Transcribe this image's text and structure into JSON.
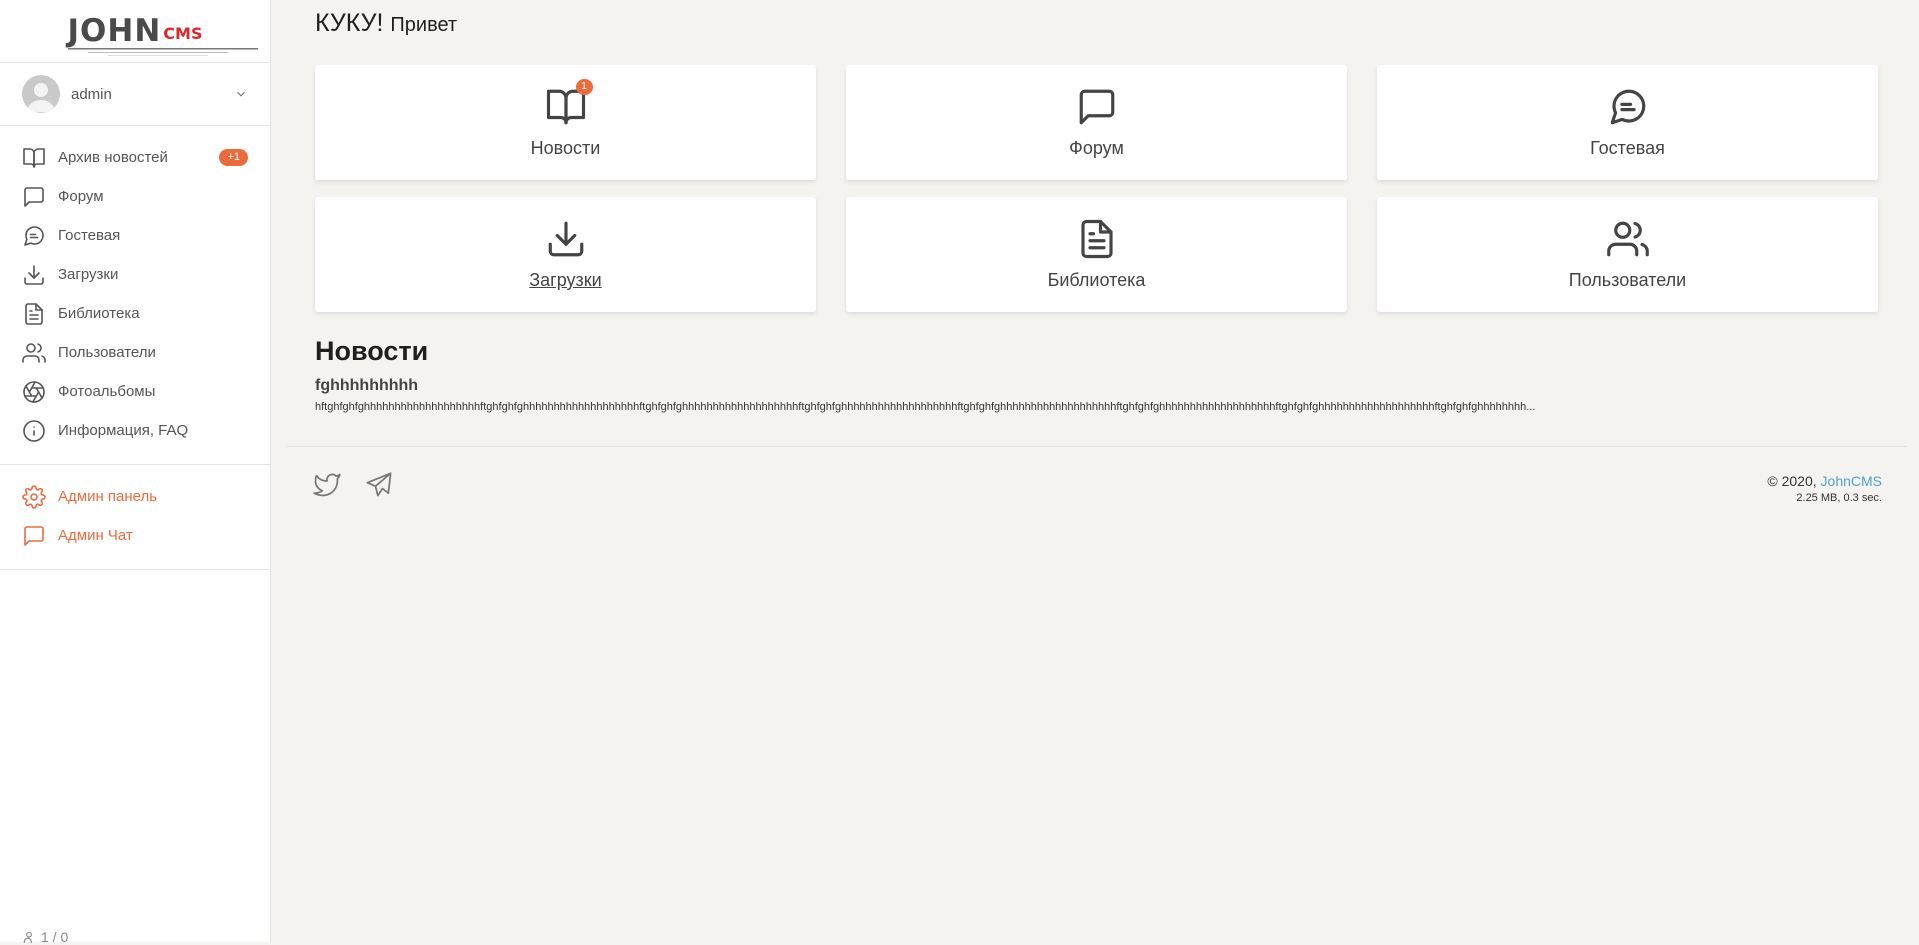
{
  "sidebar": {
    "logo": {
      "john": "JOHN",
      "cms": "CMS"
    },
    "user": {
      "name": "admin"
    },
    "nav": [
      {
        "label": "Архив новостей",
        "badge": "+1",
        "icon": "book-open-icon"
      },
      {
        "label": "Форум",
        "icon": "message-square-icon"
      },
      {
        "label": "Гостевая",
        "icon": "message-circle-icon"
      },
      {
        "label": "Загрузки",
        "icon": "download-icon"
      },
      {
        "label": "Библиотека",
        "icon": "file-text-icon"
      },
      {
        "label": "Пользователи",
        "icon": "users-icon"
      },
      {
        "label": "Фотоальбомы",
        "icon": "aperture-icon"
      },
      {
        "label": "Информация, FAQ",
        "icon": "info-icon"
      }
    ],
    "admin_nav": [
      {
        "label": "Админ панель",
        "icon": "settings-icon"
      },
      {
        "label": "Админ Чат",
        "icon": "message-square-icon"
      }
    ],
    "online": "1 / 0"
  },
  "main": {
    "greeting": {
      "big": "КУКУ!",
      "small": "Привет"
    },
    "tiles": [
      {
        "label": "Новости",
        "badge": "1",
        "icon": "book-open-icon"
      },
      {
        "label": "Форум",
        "icon": "message-square-icon"
      },
      {
        "label": "Гостевая",
        "icon": "message-circle-icon"
      },
      {
        "label": "Загрузки",
        "icon": "download-icon"
      },
      {
        "label": "Библиотека",
        "icon": "file-text-icon"
      },
      {
        "label": "Пользователи",
        "icon": "users-icon"
      }
    ],
    "news": {
      "heading": "Новости",
      "title": "fghhhhhhhhh",
      "body": "hftghfghfghhhhhhhhhhhhhhhhhhhftghfghfghhhhhhhhhhhhhhhhhhhftghfghfghhhhhhhhhhhhhhhhhhhftghfghfghhhhhhhhhhhhhhhhhhhftghfghfghhhhhhhhhhhhhhhhhhhftghfghfghhhhhhhhhhhhhhhhhhhftghfghfghhhhhhhhhhhhhhhhhhhftghfghfghhhhhhhh..."
    }
  },
  "footer": {
    "copyright_prefix": "© 2020, ",
    "copyright_link": "JohnCMS",
    "stats": "2.25 MB, 0.3 sec."
  },
  "colors": {
    "accent": "#ec6b3d",
    "link": "#4fa3c7",
    "logo_red": "#e1262b"
  }
}
